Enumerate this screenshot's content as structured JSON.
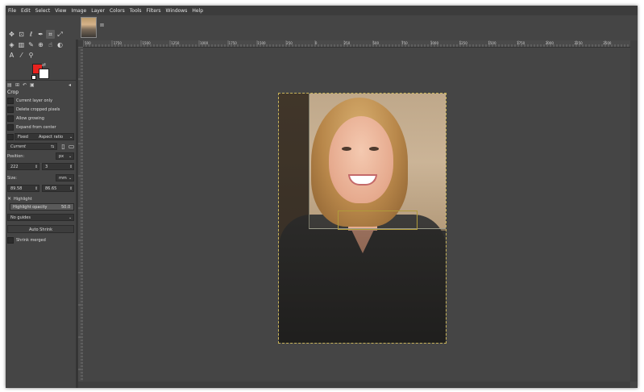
{
  "menu": [
    "File",
    "Edit",
    "Select",
    "View",
    "Image",
    "Layer",
    "Colors",
    "Tools",
    "Filters",
    "Windows",
    "Help"
  ],
  "icons": {
    "tool_move": "move-icon",
    "tool_align": "align-icon",
    "tool_lasso": "lasso-icon",
    "tool_paths": "paths-icon",
    "tool_crop": "crop-icon",
    "tool_transform": "transform-icon",
    "tool_bucket": "bucket-icon",
    "tool_gradient": "gradient-icon",
    "tool_brush": "brush-icon",
    "tool_clone": "clone-icon",
    "tool_smudge": "smudge-icon",
    "tool_dodge": "dodge-icon",
    "tool_text": "text-icon",
    "tool_picker": "color-picker-icon",
    "tool_zoom": "zoom-icon"
  },
  "colors": {
    "foreground": "#e8231f",
    "background": "#ffffff"
  },
  "tool_options": {
    "title": "Crop",
    "current_layer_only": "Current layer only",
    "delete_cropped": "Delete cropped pixels",
    "allow_growing": "Allow growing",
    "expand_from_center": "Expand from center",
    "fixed_label": "Fixed",
    "fixed_select": "Aspect ratio",
    "current": "Current",
    "position_label": "Position:",
    "position_unit": "px",
    "position_x": "222",
    "position_y": "3",
    "size_label": "Size:",
    "size_unit": "mm",
    "size_w": "89.58",
    "size_h": "86.65",
    "highlight": "Highlight",
    "highlight_opacity_label": "Highlight opacity",
    "highlight_opacity_value": "50.0",
    "guides": "No guides",
    "auto_shrink": "Auto Shrink",
    "shrink_merged": "Shrink merged"
  },
  "ruler_labels": [
    "500",
    "1750",
    "1500",
    "1250",
    "1000",
    "1750",
    "1500",
    "250",
    "0",
    "250",
    "500",
    "750",
    "1000",
    "1250",
    "1500",
    "1750",
    "2000",
    "2250",
    "2500"
  ]
}
